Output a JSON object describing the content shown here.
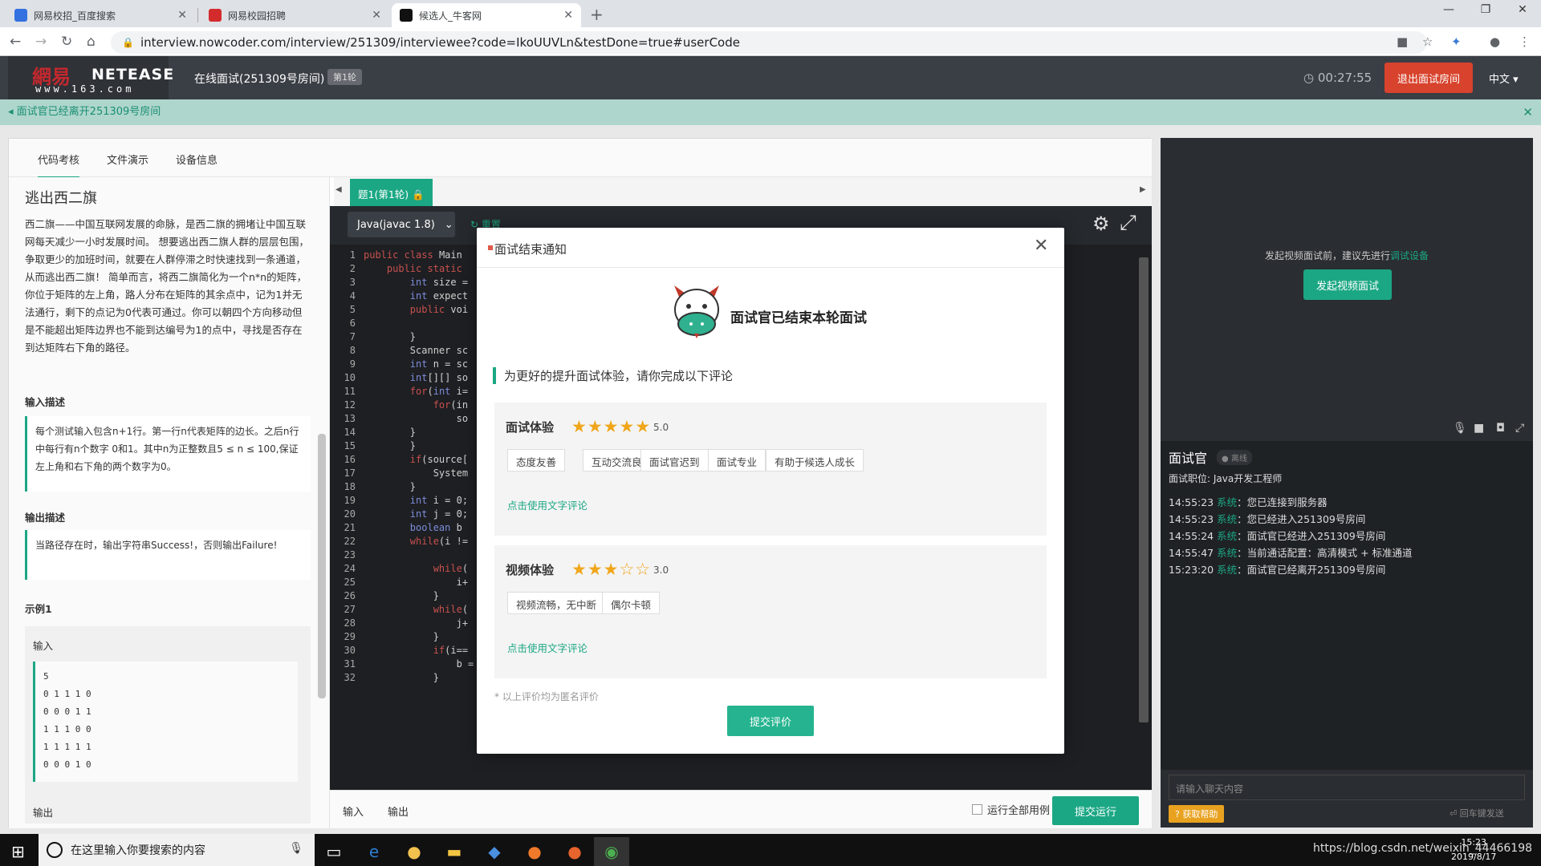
{
  "browser": {
    "tabs": [
      {
        "label": "网易校招_百度搜索",
        "favicon_color": "#3370e0"
      },
      {
        "label": "网易校园招聘",
        "favicon_color": "#d32b2b"
      },
      {
        "label": "候选人_牛客网",
        "favicon_color": "#111111"
      }
    ],
    "url": "interview.nowcoder.com/interview/251309/interviewee?code=IkoUUVLn&testDone=true#userCode"
  },
  "header": {
    "logo_cn": "網易",
    "logo_en": "NETEASE",
    "logo_domain": "www.163.com",
    "room_title": "在线面试(251309号房间)",
    "round_badge": "第1轮",
    "timer": "00:27:55",
    "exit_label": "退出面试房间",
    "language": "中文"
  },
  "notice": "面试官已经离开251309号房间",
  "panel_tabs": [
    "代码考核",
    "文件演示",
    "设备信息"
  ],
  "question": {
    "title": "逃出西二旗",
    "description": "西二旗——中国互联网发展的命脉，是西二旗的拥堵让中国互联网每天减少一小时发展时间。 想要逃出西二旗人群的层层包围，争取更少的加班时间，就要在人群停滞之时快速找到一条通道，从而逃出西二旗！ 简单而言，将西二旗简化为一个n*n的矩阵，你位于矩阵的左上角，路人分布在矩阵的其余点中，记为1并无法通行，剩下的点记为0代表可通过。你可以朝四个方向移动但是不能超出矩阵边界也不能到达编号为1的点中，寻找是否存在到达矩阵右下角的路径。",
    "input_heading": "输入描述",
    "input_desc": "每个测试输入包含n+1行。第一行n代表矩阵的边长。之后n行中每行有n个数字 0和1。其中n为正整数且5 ≤ n ≤ 100,保证左上角和右下角的两个数字为0。",
    "output_heading": "输出描述",
    "output_desc": "当路径存在时，输出字符串Success!，否则输出Failure!",
    "example_heading": "示例1",
    "sample_input_label": "输入",
    "sample_input": [
      "5",
      "0 1 1 1 0",
      "0 0 0 1 1",
      "1 1 1 0 0",
      "1 1 1 1 1",
      "0 0 0 1 0"
    ],
    "sample_output_label": "输出"
  },
  "editor": {
    "tab_label": "题1(第1轮)",
    "language": "Java(javac 1.8)",
    "reset_label": "重置",
    "lines": [
      "public class Main",
      "    public static",
      "        int size =",
      "        int expect",
      "        public voi",
      "",
      "        }",
      "        Scanner sc",
      "        int n = sc",
      "        int[][] so",
      "        for(int i=",
      "            for(in",
      "                so",
      "        }",
      "        }",
      "        if(source[",
      "            System",
      "        }",
      "        int i = 0;",
      "        int j = 0;",
      "        boolean b",
      "        while(i !=",
      "",
      "            while(",
      "                i+",
      "            }",
      "            while(",
      "                j+",
      "            }",
      "            if(i==",
      "                b = ture;",
      "            }"
    ],
    "bottom_input": "输入",
    "bottom_output": "输出",
    "run_all_label": "运行全部用例",
    "submit_run_label": "提交运行"
  },
  "video": {
    "tip_prefix": "发起视频面试前，建议先进行",
    "tip_link": "调试设备",
    "start_label": "发起视频面试"
  },
  "chat": {
    "interviewer_label": "面试官",
    "status": "离线",
    "position": "面试职位: Java开发工程师",
    "messages": [
      {
        "time": "14:55:23",
        "sender": "系统",
        "text": "：您已连接到服务器"
      },
      {
        "time": "14:55:23",
        "sender": "系统",
        "text": "：您已经进入251309号房间"
      },
      {
        "time": "14:55:24",
        "sender": "系统",
        "text": "：面试官已经进入251309号房间"
      },
      {
        "time": "14:55:47",
        "sender": "系统",
        "text": "：当前通话配置：高清模式 + 标准通道"
      },
      {
        "time": "15:23:20",
        "sender": "系统",
        "text": "：面试官已经离开251309号房间"
      }
    ],
    "input_placeholder": "请输入聊天内容",
    "help_label": "获取帮助",
    "enter_hint": "回车键发送"
  },
  "modal": {
    "title": "面试结束通知",
    "ended_text": "面试官已结束本轮面试",
    "prompt": "为更好的提升面试体验，请你完成以下评论",
    "sections": [
      {
        "title": "面试体验",
        "stars": 5,
        "score": "5.0",
        "tags": [
          "态度友善",
          "互动交流良好",
          "面试官迟到",
          "面试专业",
          "有助于候选人成长"
        ],
        "text_link": "点击使用文字评论"
      },
      {
        "title": "视频体验",
        "stars": 3,
        "score": "3.0",
        "tags": [
          "视频流畅，无中断",
          "偶尔卡顿"
        ],
        "text_link": "点击使用文字评论"
      }
    ],
    "anonymous_note": "* 以上评价均为匿名评价",
    "submit_label": "提交评价"
  },
  "taskbar": {
    "search_placeholder": "在这里输入你要搜索的内容",
    "tray_text": "https://blog.csdn.net/weixin_44466198",
    "time": "15:23",
    "date": "2019/8/17"
  }
}
